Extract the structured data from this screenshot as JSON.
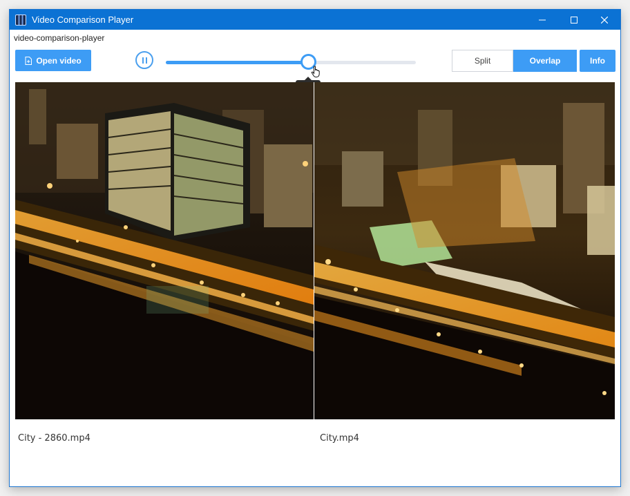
{
  "window": {
    "title": "Video Comparison Player"
  },
  "app": {
    "header": "video-comparison-player"
  },
  "toolbar": {
    "open_label": "Open video",
    "slider_value": 57,
    "slider_max": 100,
    "modes": [
      {
        "label": "Split"
      },
      {
        "label": "Overlap"
      }
    ],
    "active_mode": "Overlap",
    "info_label": "Info"
  },
  "videos": {
    "left": {
      "filename": "City - 2860.mp4"
    },
    "right": {
      "filename": "City.mp4"
    }
  },
  "colors": {
    "accent": "#3d9cf5",
    "titlebar": "#0b72d4"
  }
}
